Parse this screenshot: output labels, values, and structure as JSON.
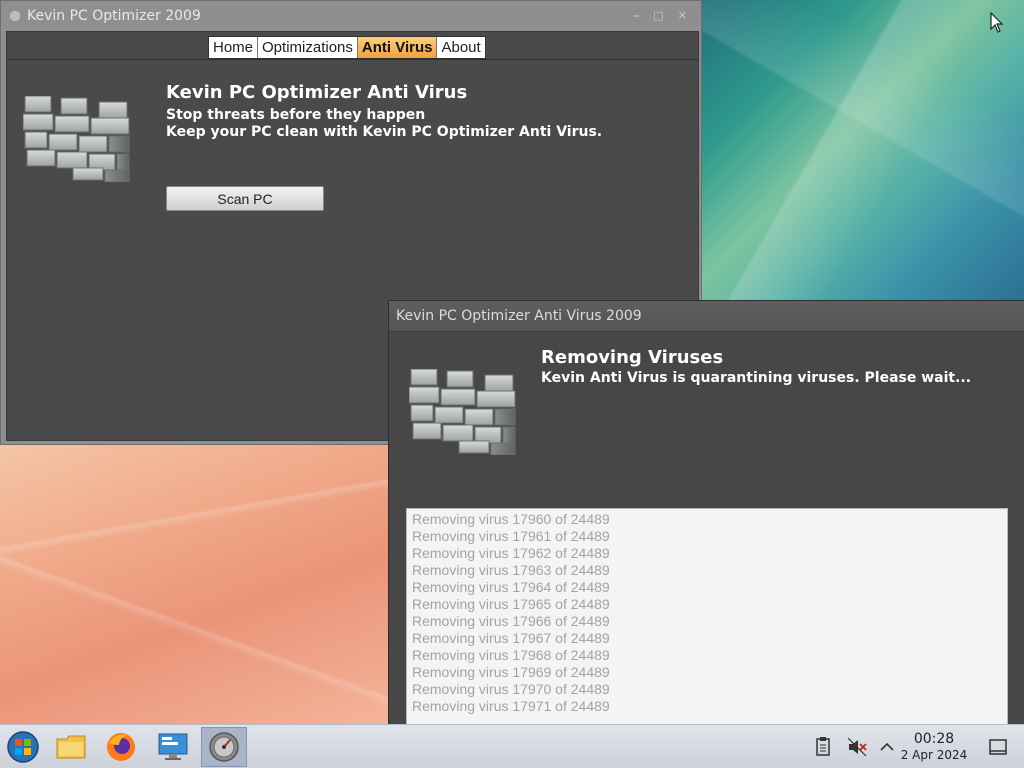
{
  "main_window": {
    "title": "Kevin PC Optimizer 2009",
    "tabs": [
      {
        "label": "Home"
      },
      {
        "label": "Optimizations"
      },
      {
        "label": "Anti Virus"
      },
      {
        "label": "About"
      }
    ],
    "active_tab": "Anti Virus",
    "heading": "Kevin PC Optimizer Anti Virus",
    "line1": "Stop threats before they happen",
    "line2": "Keep your PC clean with Kevin PC Optimizer Anti Virus.",
    "scan_button": "Scan PC"
  },
  "dialog": {
    "title": "Kevin PC Optimizer Anti Virus 2009",
    "heading": "Removing Viruses",
    "message": "Kevin Anti Virus is quarantining viruses. Please wait...",
    "log": [
      "Removing virus 17960 of 24489",
      "Removing virus 17961 of 24489",
      "Removing virus 17962 of 24489",
      "Removing virus 17963 of 24489",
      "Removing virus 17964 of 24489",
      "Removing virus 17965 of 24489",
      "Removing virus 17966 of 24489",
      "Removing virus 17967 of 24489",
      "Removing virus 17968 of 24489",
      "Removing virus 17969 of 24489",
      "Removing virus 17970 of 24489",
      "Removing virus 17971 of 24489"
    ]
  },
  "taskbar": {
    "apps": [
      "start-orb-icon",
      "file-manager-icon",
      "firefox-icon",
      "control-panel-icon",
      "optimizer-app-icon"
    ],
    "clock_time": "00:28",
    "clock_date": "2 Apr 2024"
  }
}
